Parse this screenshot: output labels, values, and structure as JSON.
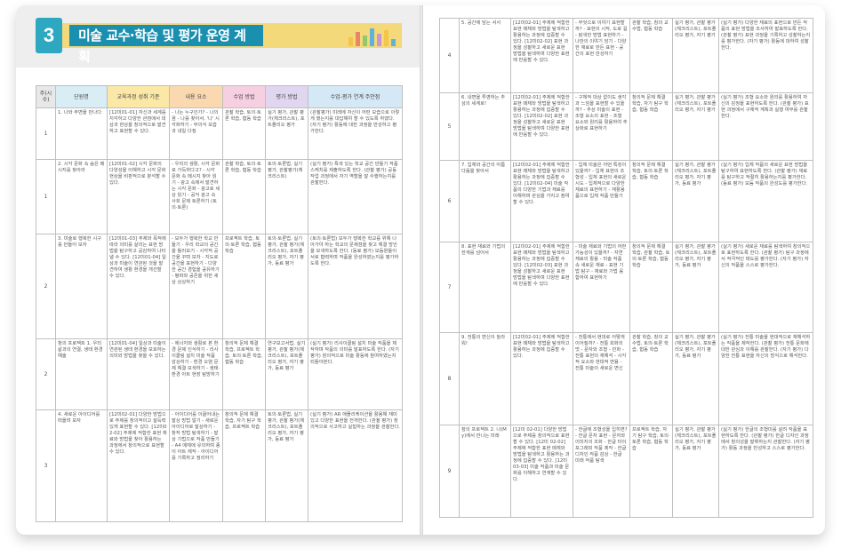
{
  "chapter": {
    "number": "3",
    "title": "미술 교수·학습 및 평가 운영 계획"
  },
  "colors": {
    "chapter_blue": "#1b8fb0",
    "chapter_teal": "#2ea8c0",
    "chapter_yellow": "#f3d97a"
  },
  "bar_icon_colors": [
    "#f3c54a",
    "#e9866a",
    "#8fc96b",
    "#5fb3d9",
    "#c895d6",
    "#f3c54a",
    "#5fb3d9"
  ],
  "left_headers": [
    "주(시수)",
    "단원명",
    "교육과정 성취 기준",
    "내용 요소",
    "수업 방법",
    "평가 방법",
    "수업-평가 연계 주안점"
  ],
  "left_rows": [
    {
      "week": "1",
      "unit": "1. 나와 주변을 만나다",
      "standard": "[12미01-01] 자신과 세계를 지각하고 다양한 관점에서 대상과 현상을 창의적으로 발견하고 표현할 수 있다.",
      "content": "- 나는 누구인가? - 나의 꿈 - 나를 찾아서, '나' 시각화하기 - 무의식 모습과 내일 다짐",
      "method": "관찰 학습, 토의·토론 학습, 협동 학습",
      "eval": "실기 평가, 관찰 평가(체크리스트), 포트폴리오 평가",
      "point": "(관찰평가) 미래에 자신이 어떤 모습으로 이렇게 했는지를 대답해야 할 수 있도록 하였다. (자기 평가) 활동에 대한 과정을 반성하고 평가한다."
    },
    {
      "week": "1",
      "unit": "2. 시각 문화 속 숨은 메시지를 찾아라",
      "standard": "[12미01-02] 시각 문화의 다양성을 이해하고 시각 문화 현상을 비판적으로 분석할 수 있다.",
      "content": "- 우리의 생활, 시각 문화로 가득하다고? - 시각 문화 속 메시지 찾아 읽기 - 광고 속에서 발견하는 시각 문화 - 광고로 세상 읽기 - 공익 광고 속 사회 문제 토론하기 (토의·토론)",
      "method": "관찰 학습, 토의·토론 학습, 협동 학습",
      "eval": "토의·토론법, 실기 평가, 관찰평가(체크리스트)",
      "point": "(실기 평가) 특색 있는 학교 공간 만들기 작품 스케치를 제출하도록 한다. (관찰 평가) 공동 작업 과정에서 자기 역할을 잘 수행하는지를 관찰한다."
    },
    {
      "week": "2",
      "unit": "3. 미술로 행복한 시구를 만들어 보자",
      "standard": "[12미01-03] 주제와 목적에 따라 의미를 살리는 표현 방법을 탐구하고 공감하여 나타낼 수 있다. [12미01-04] 일상과 미술이 연관된 것을 발견하여 생활 환경을 개선할 수 있다.",
      "content": "- 모두가 행복한 학교 만들기 - 우리 학교의 공간을 둘러보기 - 시각적 공간을 꾸며 보자 - 지도로 공간을 표현하기 - 다양한 공간 경험을 공유하기 - 평화와 공존을 위한 세상 상상하기",
      "method": "프로젝트 학습, 토의·토론 학습, 협동 학습",
      "eval": "토의·토론법, 실기 평가, 관찰 평가(체크리스트), 포트폴리오 평가, 자기 평가, 동료 평가",
      "point": "(토의·토론법) 모두가 행복한 학교를 위해 나아가야 하는 학교의 문제점을 찾고 해결 방안을 모색하도록 한다. (동료 평가) 모둠원들이 서로 협력하며 작품을 완성하였는지를 평가하도록 한다."
    },
    {
      "week": "2",
      "unit": "창의 프로젝트 1. 우리 삶과의 연결, 생태 환경 예술",
      "standard": "[12미01-04] 일상과 미술이 연관된 생태 환경을 보호하는 의미와 방법을 찾을 수 있다.",
      "content": "- 에너지와 생활로 본 환경 문제 인식하기 - 리사이클링 설치 미술 작품 감상하기 - 환경 오염 문제 해결 모색하기 - 생태·환경 아트 현장 탐방하기",
      "method": "창의적 문제 해결 학습, 프로젝트 학습, 토의·토론 학습, 협동 학습",
      "eval": "연구보고서법, 실기 평가, 관찰 평가(체크리스트), 포트폴리오 평가, 자기 평가, 동료 평가",
      "point": "(실기 평가) 리사이클링 설치 미술 작품을 제작하며 작품의 의미를 발표하도록 한다. (자기 평가) 창의적으로 미술 활동에 참여하였는지 되돌아본다."
    },
    {
      "week": "3",
      "unit": "4. 새로운 아이디어를 떠올려 보자",
      "standard": "[12미02-01] 다양한 방법으로 주제를 창의적이고 설득력 있게 표현할 수 있다. [12미02-02] 주제에 적합한 표현 재료와 방법을 찾아 활용하는 과정에서 창의적으로 표현할 수 있다.",
      "content": "- 아이디어를 이끌어내는 발상 방법 알기 - 새로운 아이디어로 발상하기 - 창작 방법 탐색하기 - 발상 기법으로 작품 만들기 - A4 매체에 유의하며 종이 아트 제작 - 아이디어를 기록하고 정리하기",
      "method": "창의적 문제 해결 학습, 자기 탐구 학습, 프로젝트 학습",
      "eval": "토의·토론법, 실기 평가, 관찰 평가(체크리스트), 포트폴리오 평가, 자기 평가, 동료 평가",
      "point": "(실기 평가) AR 애플리케이션을 활용해 재미있고 다양한 표현을 전개한다. (관찰 평가) 창의적으로 사고하고 실험하는 과정을 관찰한다."
    }
  ],
  "right_rows": [
    {
      "week": "4",
      "unit": "5. 공간에 담는 서사",
      "standard": "[12미02-01] 주제에 적합한 표현 매체와 방법을 탐색하고 활용하는 과정에 집중할 수 있다. [12미02-02] 표현 과정을 성찰하고 새로운 표현 방법을 탐색하며 다양한 표현에 반응할 수 있다.",
      "content": "- 무엇으로 이야기 표현할까? - 표현의 시작, 도로 길 - 탐색한 방법 표현하기 - 나만의 이야기 담기 - 다양한 재료로 만든 표현 - 공간의 표현 완성하기",
      "method": "관찰 학습, 창의 교수법, 협동 학습",
      "eval": "실기 평가, 관찰 평가(체크리스트), 포트폴리오 평가, 자기 평가",
      "point": "(실기 평가) 다양한 재료의 표현으로 만든 작품의 표현 방법을 조사하여 발표하도록 한다. (관찰 평가) 표현 과정을 기록하고 성찰하는지를 평가한다. (자기 평가) 활동에 대하여 성찰한다."
    },
    {
      "week": "5",
      "unit": "6. 내면을 투영하는 추상의 세계로!",
      "standard": "[12미02-01] 주제에 적합한 표현 매체와 방법을 탐색하고 활용하는 과정에 집중할 수 있다. [12미02-02] 표현 과정을 성찰하고 새로운 표현 방법을 탐색하며 다양한 표현에 반응할 수 있다.",
      "content": "- 구체적 대상 없이도 생각과 느낌을 표현할 수 있을까? - 추상 미술의 표현 - 조형 요소의 표현 - 조형 요소와 원리를 활용하여 추상화로 표현하기",
      "method": "창의적 문제 해결 학습, 자기 탐구 학습, 협동 학습",
      "eval": "실기 평가, 관찰 평가(체크리스트), 포트폴리오 평가, 자기 평가",
      "point": "(실기 평가) 조형 요소와 원리를 활용하여 자신의 감정을 표현하도록 한다. (관찰 평가) 표현 과정에서 구체적 계획과 실행 여부를 관찰한다."
    },
    {
      "week": "6",
      "unit": "7. 입체와 공간의 아름다움을 찾아서",
      "standard": "[12미02-01] 주제에 적합한 표현 매체와 방법을 탐색하고 활용하는 과정에 집중할 수 있다. [12미02-04] 미술 작품의 다양한 기법과 재료를 이해하며 관심을 가지고 참여할 수 있다.",
      "content": "- 입체 미술은 어떤 특징이 있을까? - 입체 표현의 조형성 - 입체 표현의 새로운 시도 - 입체적으로 다양한 재료의 표현하기 - 재활용품으로 입체 작품 만들기",
      "method": "창의적 문제 해결 학습, 토의·토론 학습, 협동 학습",
      "eval": "실기 평가, 관찰 평가(체크리스트), 포트폴리오 평가, 자기 평가, 동료 평가",
      "point": "(실기 평가) 입체 작품의 새로운 표현 방법을 탐구하여 표현하도록 한다. (관찰 평가) 재료를 탐구하고 적절히 활용하는지를 평가한다. (동료 평가) 모둠 작품의 완성도를 평가한다."
    },
    {
      "week": "7",
      "unit": "8. 표현 재료와 기법의 한계를 넘어서",
      "standard": "[12미02-01] 주제에 적합한 표현 매체와 방법을 탐색하고 활용하는 과정에 집중할 수 있다. [12미02-03] 표현 과정을 성찰하고 새로운 표현 방법을 탐색하며 다양한 표현에 반응할 수 있다.",
      "content": "- 미술 재료와 기법의 어떤 가능성이 있을까? - 자연 재료의 활용 - 미술 작품 속 새로운 재료 - 표현 기법 탐구 - 재료와 기법 융합하여 표현하기",
      "method": "창의적 문제 해결 학습, 관찰 학습, 토의·토론 학습, 협동 학습",
      "eval": "실기 평가, 관찰 평가(체크리스트), 포트폴리오 평가, 자기 평가, 동료 평가",
      "point": "(실기 평가) 새로운 재료를 탐색하여 창의적으로 표현하도록 한다. (관찰 평가) 탐구 과정에서 적극적인 태도를 평가한다. (자기 평가) 자신의 작품을 스스로 평가한다."
    },
    {
      "week": "8",
      "unit": "9. 전통의 변신이 놀라워!",
      "standard": "[12미02-01] 주제에 적합한 표현 매체와 방법을 탐색하고 활용하는 과정에 집중할 수 있다.",
      "content": "- 전통에서 현대로 어떻게 이어질까? - 전통 회화의 멋 - 문자와 조형 - 민화 - 전통 표현의 재해석 - 시각적 요소와 현대적 변용 - 전통 미술의 새로운 변신",
      "method": "관찰 학습, 창의 교수법, 토의·토론 학습, 협동 학습",
      "eval": "실기 평가, 관찰 평가(체크리스트), 포트폴리오 평가, 자기 평가, 동료 평가",
      "point": "(실기 평가) 전통 미술을 현대적으로 재해석하는 작품을 제작한다. (관찰 평가) 전통 문화에 대한 관심과 이해를 관찰한다. (자기 평가) 다양한 전통 표현을 자신의 방식으로 해석한다."
    },
    {
      "week": "9",
      "unit": "창의 프로젝트 2. 나(My)에서 만나는 미래",
      "standard": "[12미 02-01] 다양한 방법으로 주제를 창의적으로 표현할 수 있다. [12미 02-02] 주제에 적합한 표현 매체와 방법을 탐색하고 활용하는 과정에 집중할 수 있다. [12미 03-03] 미술 작품과 미술 문화를 이해하고 연계할 수 있다.",
      "content": "- 한글에 조형성을 입히면? - 한글 문자 표현 - 문자와 이미지의 조화 - 한글 타이포그래피 작품 제작 - 한글 디자인 작품 감상 - 한글 미래 작품 탐색",
      "method": "프로젝트 학습, 자기 탐구 학습, 토의·토론 학습, 협동 학습",
      "eval": "실기 평가, 관찰 평가(체크리스트), 포트폴리오 평가, 자기 평가, 동료 평가",
      "point": "(실기 평가) 한글의 조형미를 살려 작품을 표현하도록 한다. (관찰 평가) 한글 디자인 과정에서 창의성을 발휘하는지 관찰한다. (자기 평가) 활동 과정을 반성하고 스스로 평가한다."
    }
  ]
}
